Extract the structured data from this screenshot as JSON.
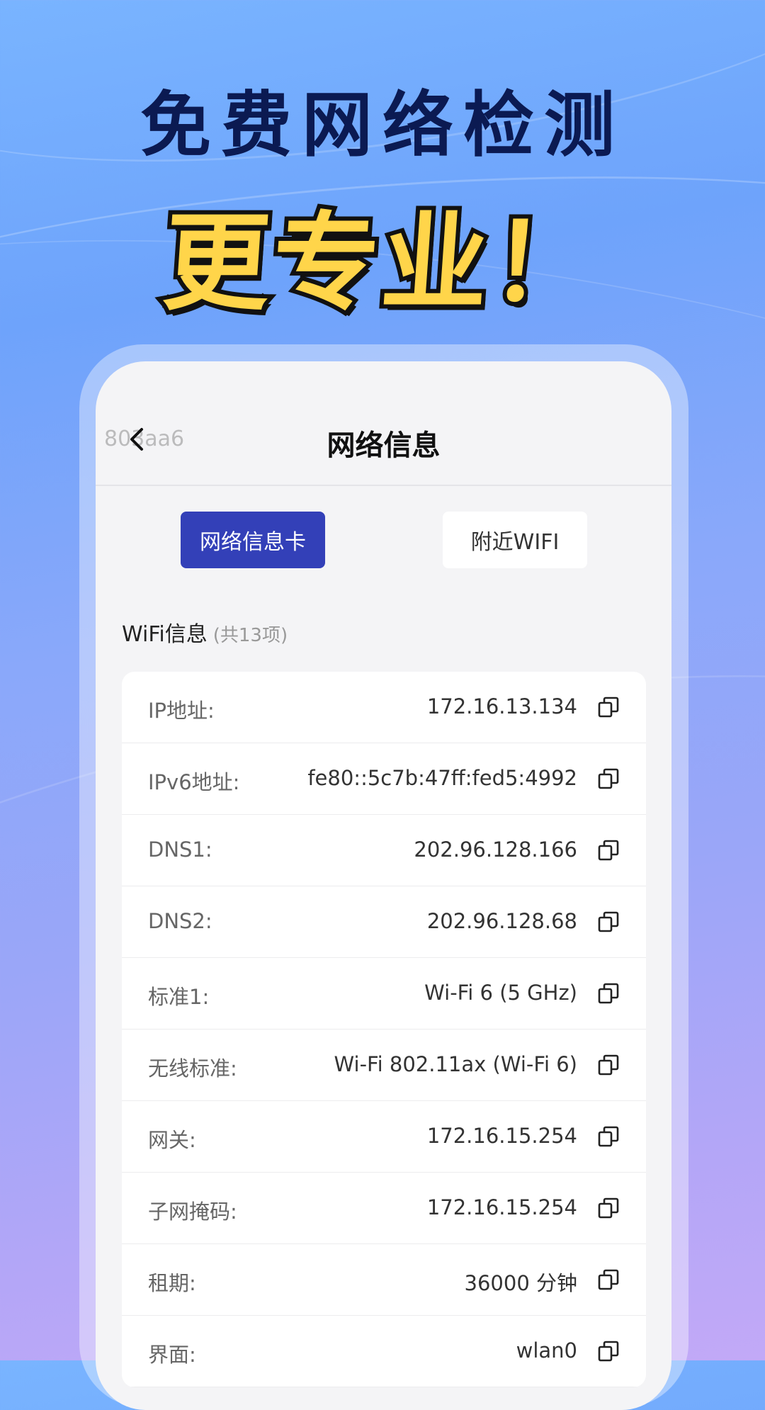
{
  "promo": {
    "headline_line1": "免费网络检测",
    "headline_line2": "更专业！"
  },
  "header": {
    "title": "网络信息",
    "watermark": "803aa6",
    "back_icon": "chevron-left-icon"
  },
  "tabs": [
    {
      "label": "网络信息卡",
      "active": true
    },
    {
      "label": "附近WIFI",
      "active": false
    }
  ],
  "section": {
    "title": "WiFi信息",
    "count": "(共13项)"
  },
  "rows": [
    {
      "label": "IP地址:",
      "value": "172.16.13.134"
    },
    {
      "label": "IPv6地址:",
      "value": "fe80::5c7b:47ff:fed5:4992"
    },
    {
      "label": "DNS1:",
      "value": "202.96.128.166"
    },
    {
      "label": "DNS2:",
      "value": "202.96.128.68"
    },
    {
      "label": "标准1:",
      "value": "Wi-Fi 6 (5 GHz)"
    },
    {
      "label": "无线标准:",
      "value": "Wi-Fi 802.11ax (Wi-Fi 6)"
    },
    {
      "label": "网关:",
      "value": "172.16.15.254"
    },
    {
      "label": "子网掩码:",
      "value": "172.16.15.254"
    },
    {
      "label": "租期:",
      "value": "36000 分钟"
    },
    {
      "label": "界面:",
      "value": "wlan0"
    }
  ],
  "colors": {
    "accent": "#3340b8",
    "headline_dark": "#0b1a52",
    "headline_yellow": "#ffd54a"
  },
  "icons": {
    "copy": "copy-icon"
  }
}
